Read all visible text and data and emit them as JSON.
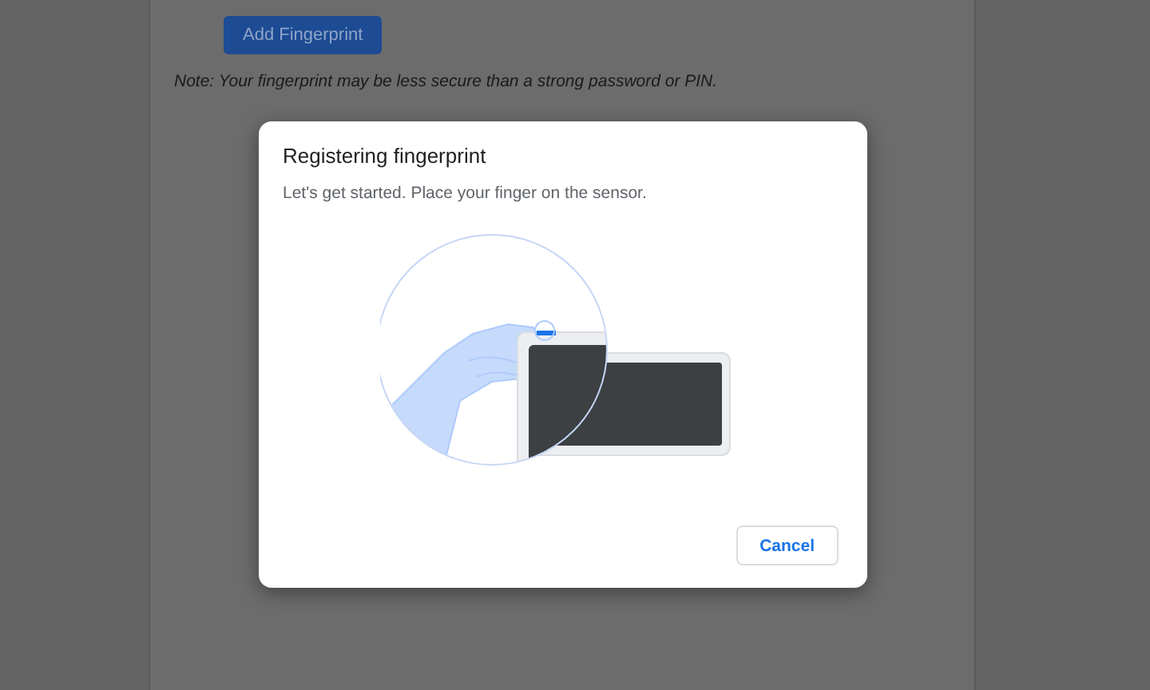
{
  "page": {
    "add_button": "Add Fingerprint",
    "note": "Note: Your fingerprint may be less secure than a strong password or PIN."
  },
  "dialog": {
    "title": "Registering fingerprint",
    "message": "Let's get started. Place your finger on the sensor.",
    "buttons": [
      "Cancel"
    ]
  }
}
